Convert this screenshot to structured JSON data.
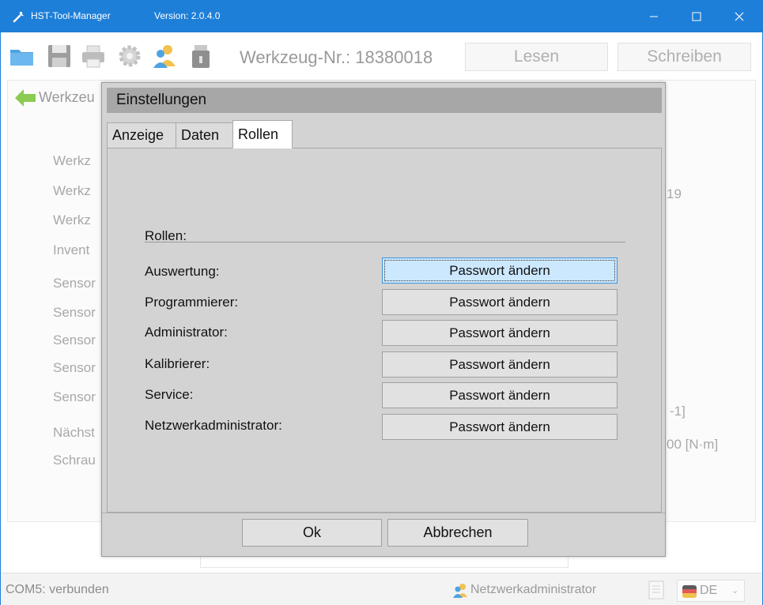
{
  "window": {
    "title": "HST-Tool-Manager",
    "version": "Version: 2.0.4.0",
    "accent_color": "#1e7fd8"
  },
  "toolbar": {
    "icons": [
      "folder-icon",
      "save-icon",
      "print-icon",
      "gear-icon",
      "users-icon",
      "usb-drive-icon"
    ],
    "tool_label": "Werkzeug-Nr.: 18380018",
    "read_label": "Lesen",
    "write_label": "Schreiben"
  },
  "background": {
    "back_label": "Werkzeu",
    "labels": [
      "Werkz",
      "Werkz",
      "Werkz",
      "Invent",
      "Sensor",
      "Sensor",
      "Sensor",
      "Sensor",
      "Sensor",
      "Nächst",
      "Schrau"
    ],
    "right_values": [
      "19",
      "-1]",
      "00 [N·m]"
    ]
  },
  "dialog": {
    "title": "Einstellungen",
    "tabs": [
      {
        "label": "Anzeige",
        "active": false
      },
      {
        "label": "Daten",
        "active": false
      },
      {
        "label": "Rollen",
        "active": true
      }
    ],
    "section_label": "Rollen:",
    "roles": [
      {
        "label": "Auswertung:",
        "button": "Passwort ändern"
      },
      {
        "label": "Programmierer:",
        "button": "Passwort ändern"
      },
      {
        "label": "Administrator:",
        "button": "Passwort ändern"
      },
      {
        "label": "Kalibrierer:",
        "button": "Passwort ändern"
      },
      {
        "label": "Service:",
        "button": "Passwort ändern"
      },
      {
        "label": "Netzwerkadministrator:",
        "button": "Passwort ändern"
      }
    ],
    "ok_label": "Ok",
    "cancel_label": "Abbrechen"
  },
  "statusbar": {
    "connection": "COM5: verbunden",
    "user": "Netzwerkadministrator",
    "language": "DE"
  }
}
